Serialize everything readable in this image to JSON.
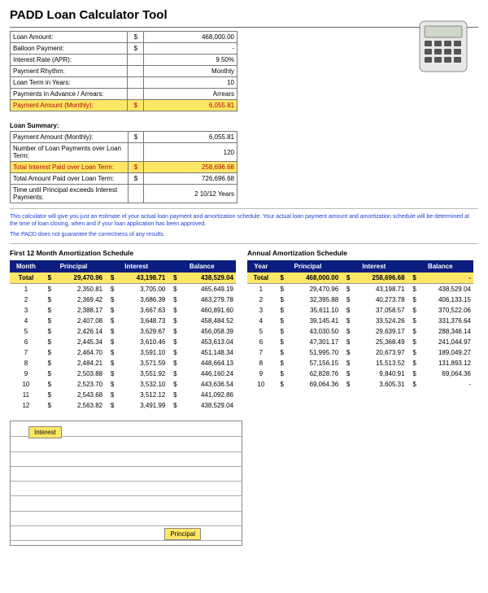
{
  "title": "PADD Loan Calculator Tool",
  "inputs": [
    {
      "label": "Loan Amount:",
      "cur": "$",
      "val": "468,000.00",
      "hl": false
    },
    {
      "label": "Balloon Payment:",
      "cur": "$",
      "val": "-",
      "hl": false
    },
    {
      "label": "Interest Rate (APR):",
      "cur": "",
      "val": "9.50%",
      "hl": false
    },
    {
      "label": "Payment Rhythm:",
      "cur": "",
      "val": "Monthly",
      "hl": false
    },
    {
      "label": "Loan Term in Years:",
      "cur": "",
      "val": "10",
      "hl": false
    },
    {
      "label": "Payments in Advance / Arrears:",
      "cur": "",
      "val": "Arrears",
      "hl": false
    },
    {
      "label": "Payment Amount (Monthly):",
      "cur": "$",
      "val": "6,055.81",
      "hl": true
    }
  ],
  "summary_title": "Loan Summary:",
  "summary": [
    {
      "label": "Payment Amount (Monthly):",
      "cur": "$",
      "val": "6,055.81",
      "hl": false
    },
    {
      "label": "Number of Loan Payments over Loan Term:",
      "cur": "",
      "val": "120",
      "hl": false
    },
    {
      "label": "Total Interest Paid over Loan Term:",
      "cur": "$",
      "val": "258,696.68",
      "hl": true
    },
    {
      "label": "Total Amount Paid over Loan Term:",
      "cur": "$",
      "val": "726,696.68",
      "hl": false
    },
    {
      "label": "Time until Principal exceeds Interest Payments:",
      "cur": "",
      "val": "2 10/12 Years",
      "hl": false
    }
  ],
  "disclaimer1": "This calculator will give you just an estimate of your actual loan payment and amortization schedule. Your actual loan payment amount and amortization schedule will be determined at the time of loan closing, when and if your loan application has been approved.",
  "disclaimer2": "The PADD does not guarantee the correctness of any results.",
  "monthly_title": "First 12 Month Amortization Schedule",
  "annual_title": "Annual Amortization Schedule",
  "headers": {
    "period_m": "Month",
    "period_y": "Year",
    "principal": "Principal",
    "interest": "Interest",
    "balance": "Balance"
  },
  "monthly_total": {
    "period": "Total",
    "principal": "29,470.96",
    "interest": "43,198.71",
    "balance": "438,529.04"
  },
  "monthly": [
    {
      "p": "1",
      "pr": "2,350.81",
      "in": "3,705.00",
      "ba": "465,649.19"
    },
    {
      "p": "2",
      "pr": "2,369.42",
      "in": "3,686.39",
      "ba": "463,279.78"
    },
    {
      "p": "3",
      "pr": "2,388.17",
      "in": "3,667.63",
      "ba": "460,891.60"
    },
    {
      "p": "4",
      "pr": "2,407.08",
      "in": "3,648.73",
      "ba": "458,484.52"
    },
    {
      "p": "5",
      "pr": "2,426.14",
      "in": "3,629.67",
      "ba": "456,058.39"
    },
    {
      "p": "6",
      "pr": "2,445.34",
      "in": "3,610.46",
      "ba": "453,613.04"
    },
    {
      "p": "7",
      "pr": "2,464.70",
      "in": "3,591.10",
      "ba": "451,148.34"
    },
    {
      "p": "8",
      "pr": "2,484.21",
      "in": "3,571.59",
      "ba": "448,664.13"
    },
    {
      "p": "9",
      "pr": "2,503.88",
      "in": "3,551.92",
      "ba": "446,160.24"
    },
    {
      "p": "10",
      "pr": "2,523.70",
      "in": "3,532.10",
      "ba": "443,636.54"
    },
    {
      "p": "11",
      "pr": "2,543.68",
      "in": "3,512.12",
      "ba": "441,092.86"
    },
    {
      "p": "12",
      "pr": "2,563.82",
      "in": "3,491.99",
      "ba": "438,529.04"
    }
  ],
  "annual_total": {
    "period": "Total",
    "principal": "468,000.00",
    "interest": "258,696.68",
    "balance": "-"
  },
  "annual": [
    {
      "p": "1",
      "pr": "29,470.96",
      "in": "43,198.71",
      "ba": "438,529.04"
    },
    {
      "p": "2",
      "pr": "32,395.88",
      "in": "40,273.78",
      "ba": "406,133.15"
    },
    {
      "p": "3",
      "pr": "35,611.10",
      "in": "37,058.57",
      "ba": "370,522.06"
    },
    {
      "p": "4",
      "pr": "39,145.41",
      "in": "33,524.26",
      "ba": "331,376.64"
    },
    {
      "p": "5",
      "pr": "43,030.50",
      "in": "29,639.17",
      "ba": "288,346.14"
    },
    {
      "p": "6",
      "pr": "47,301.17",
      "in": "25,368.49",
      "ba": "241,044.97"
    },
    {
      "p": "7",
      "pr": "51,995.70",
      "in": "20,673.97",
      "ba": "189,049.27"
    },
    {
      "p": "8",
      "pr": "57,156.15",
      "in": "15,513.52",
      "ba": "131,893.12"
    },
    {
      "p": "9",
      "pr": "62,828.76",
      "in": "9,840.91",
      "ba": "69,064.36"
    },
    {
      "p": "10",
      "pr": "69,064.36",
      "in": "3,605.31",
      "ba": "-"
    }
  ],
  "chart": {
    "legend_interest": "Interest",
    "legend_principal": "Principal"
  }
}
